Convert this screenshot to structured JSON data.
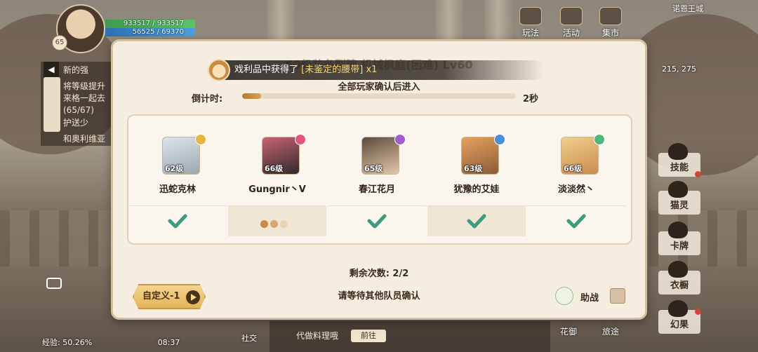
{
  "hud": {
    "level": "65",
    "hp": "933517 / 933517",
    "mp": "56525 / 69370",
    "region": "诺恩王城",
    "coords": "215, 275",
    "exp": "经验: 50.26%",
    "time": "08:37"
  },
  "task_panel": {
    "items": [
      "新的强",
      "将等级提升 来格一起去 (65/67)",
      "护送少",
      "和奥利维亚"
    ]
  },
  "top_buttons": [
    "玩法",
    "活动",
    "集市"
  ],
  "side_buttons": [
    "技能",
    "猫灵",
    "卡牌",
    "衣橱",
    "幻果"
  ],
  "bottom": {
    "social": "社交",
    "chat_text": "代做料理哦",
    "send": "前往",
    "btn1": "花御",
    "btn2": "旅途"
  },
  "toast": {
    "prefix": "戏利品中获得了",
    "item": "[未鉴定的腰带]",
    "count": "x1"
  },
  "modal": {
    "title": "60级装备裂隙 机械枫庭(困难) Lv60",
    "subtitle": "全部玩家确认后进入",
    "countdown_label": "倒计时:",
    "countdown_value": "2秒",
    "countdown_progress": 0.07,
    "members": [
      {
        "name": "迅蛇克林",
        "level": "62级",
        "status": "confirmed"
      },
      {
        "name": "Gungnir丶V",
        "level": "66级",
        "status": "waiting"
      },
      {
        "name": "春江花月",
        "level": "65级",
        "status": "confirmed"
      },
      {
        "name": "犹豫的艾娃",
        "level": "63级",
        "status": "confirmed"
      },
      {
        "name": "淡淡然丶",
        "level": "66级",
        "status": "confirmed"
      }
    ],
    "remaining": "剩余次数: 2/2",
    "waiting": "请等待其他队员确认",
    "custom_button": "自定义-1",
    "assist": "助战"
  },
  "colors": {
    "check": "#3f9b7d",
    "accent": "#d8a14f",
    "panel": "#f5ede0"
  }
}
